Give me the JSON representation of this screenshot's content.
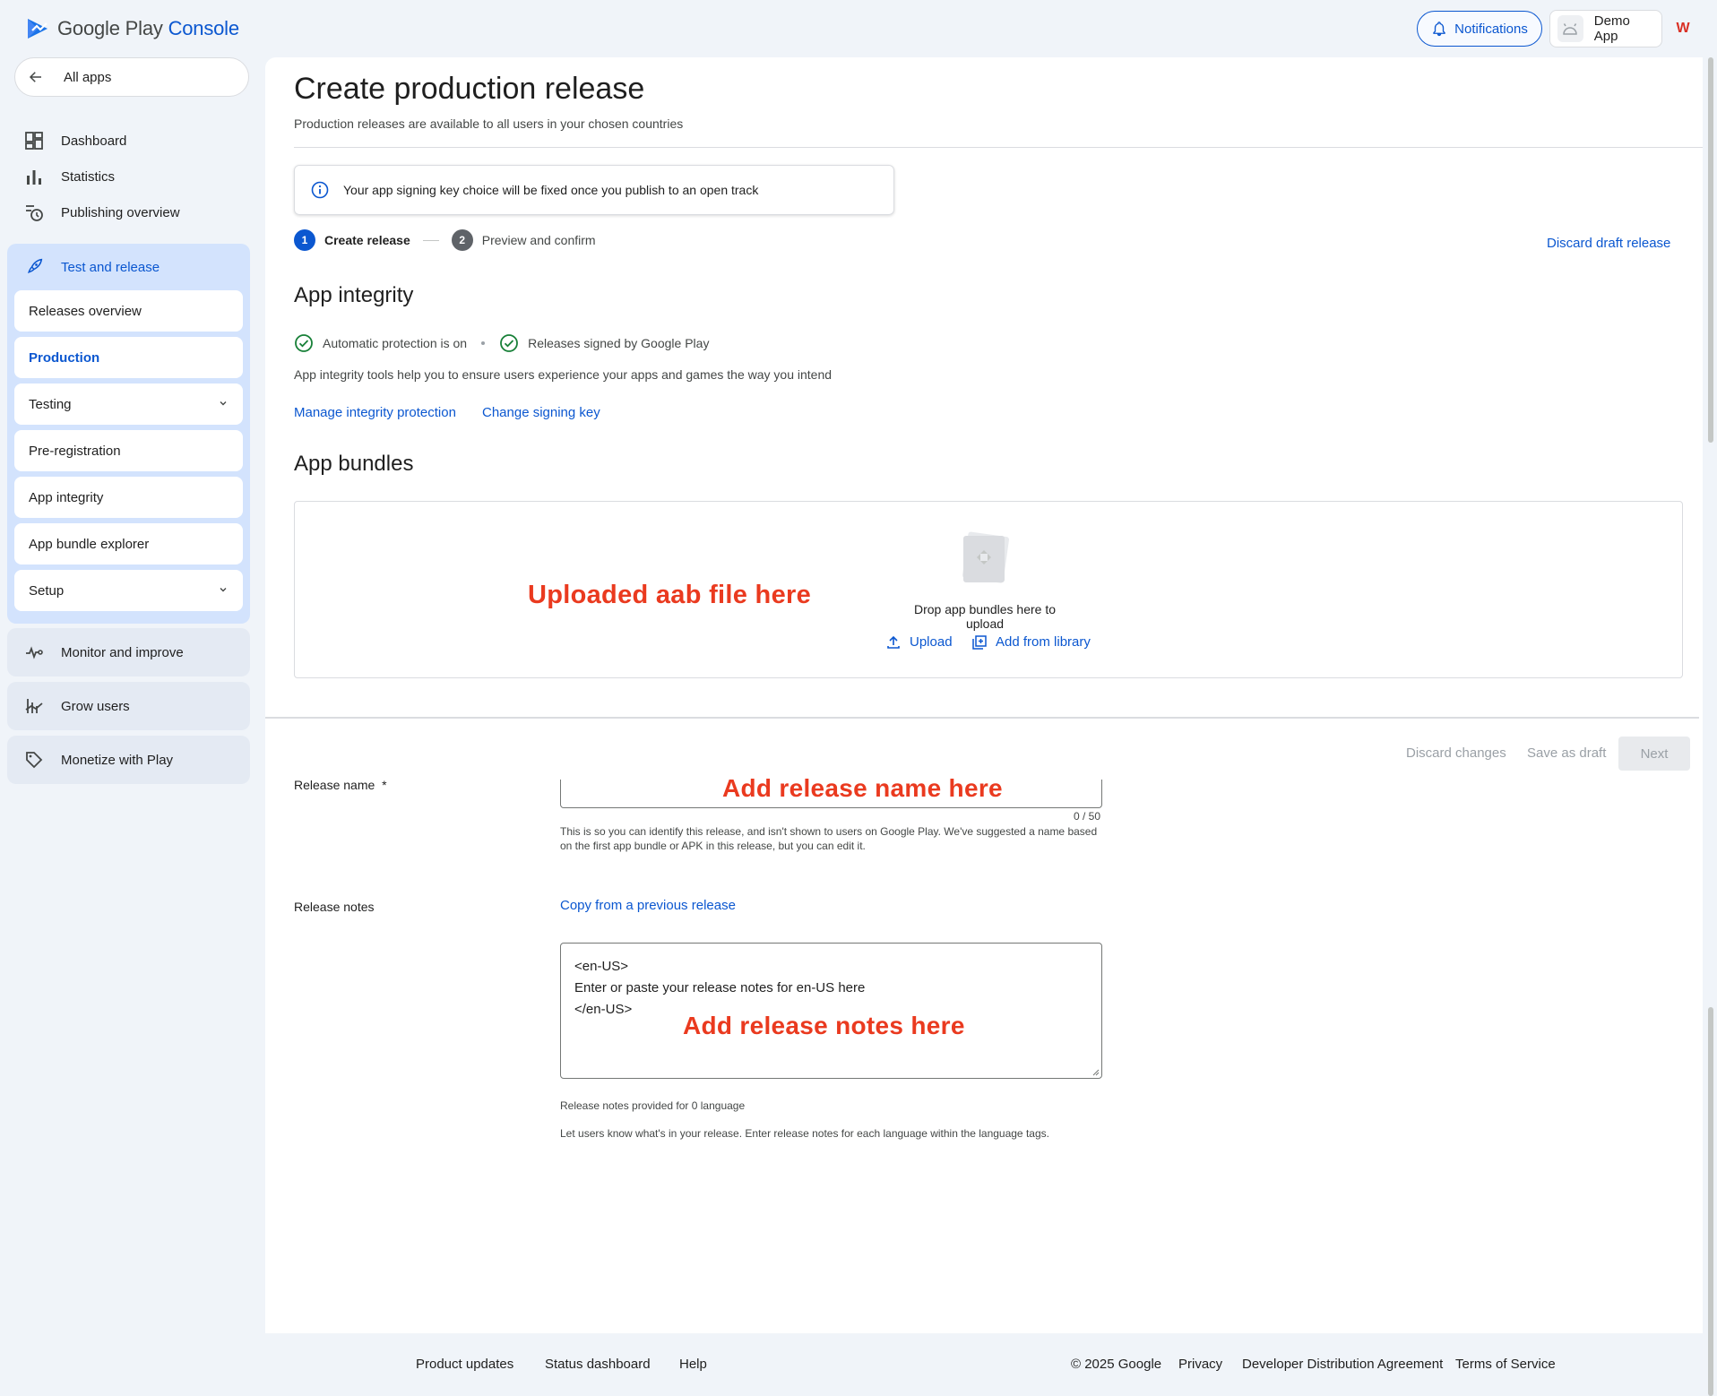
{
  "header": {
    "logo_google_play": "Google Play",
    "logo_console": "Console",
    "notifications_label": "Notifications",
    "app_name": "Demo App",
    "account_initial": "W"
  },
  "sidebar": {
    "all_apps": "All apps",
    "top_items": [
      {
        "label": "Dashboard",
        "icon": "dashboard-icon"
      },
      {
        "label": "Statistics",
        "icon": "bar-chart-icon"
      },
      {
        "label": "Publishing overview",
        "icon": "history-icon"
      }
    ],
    "active_group": {
      "label": "Test and release",
      "icon": "rocket-icon",
      "items": [
        {
          "label": "Releases overview"
        },
        {
          "label": "Production",
          "active": true
        },
        {
          "label": "Testing",
          "expandable": true
        },
        {
          "label": "Pre-registration"
        },
        {
          "label": "App integrity"
        },
        {
          "label": "App bundle explorer"
        },
        {
          "label": "Setup",
          "expandable": true
        }
      ]
    },
    "sections": [
      {
        "label": "Monitor and improve",
        "icon": "vitals-icon"
      },
      {
        "label": "Grow users",
        "icon": "grow-icon"
      },
      {
        "label": "Monetize with Play",
        "icon": "tag-icon"
      }
    ]
  },
  "main": {
    "title": "Create production release",
    "subtitle": "Production releases are available to all users in your chosen countries",
    "info_banner": "Your app signing key choice will be fixed once you publish to an open track",
    "steps": [
      {
        "number": "1",
        "label": "Create release"
      },
      {
        "number": "2",
        "label": "Preview and confirm"
      }
    ],
    "discard_draft": "Discard draft release",
    "integrity": {
      "heading": "App integrity",
      "status_1": "Automatic protection is on",
      "status_2": "Releases signed by Google Play",
      "description": "App integrity tools help you to ensure users experience your apps and games the way you intend",
      "link_manage": "Manage integrity protection",
      "link_change_key": "Change signing key"
    },
    "bundles": {
      "heading": "App bundles",
      "annotation": "Uploaded aab file here",
      "drop_text": "Drop app bundles here to upload",
      "upload_label": "Upload",
      "library_label": "Add from library"
    },
    "actions": {
      "discard_changes": "Discard changes",
      "save_draft": "Save as draft",
      "next": "Next"
    },
    "release_name": {
      "label": "Release name",
      "required_mark": "*",
      "annotation": "Add release name here",
      "counter": "0 / 50",
      "helper": "This is so you can identify this release, and isn't shown to users on Google Play. We've suggested a name based on the first app bundle or APK in this release, but you can edit it."
    },
    "release_notes": {
      "label": "Release notes",
      "copy_link": "Copy from a previous release",
      "lines": [
        "<en-US>",
        "Enter or paste your release notes for en-US here",
        "</en-US>"
      ],
      "annotation": "Add release notes here",
      "provided_count": "Release notes provided for 0 language",
      "helper": "Let users know what's in your release. Enter release notes for each language within the language tags."
    }
  },
  "footer": {
    "links_left": [
      "Product updates",
      "Status dashboard",
      "Help"
    ],
    "copyright": "© 2025 Google",
    "links_right": [
      "Privacy",
      "Developer Distribution Agreement",
      "Terms of Service"
    ]
  },
  "colors": {
    "accent": "#0b57d0",
    "annotation": "#ea3a1f",
    "success": "#188038",
    "sidebar_active_bg": "#d3e3fd"
  }
}
